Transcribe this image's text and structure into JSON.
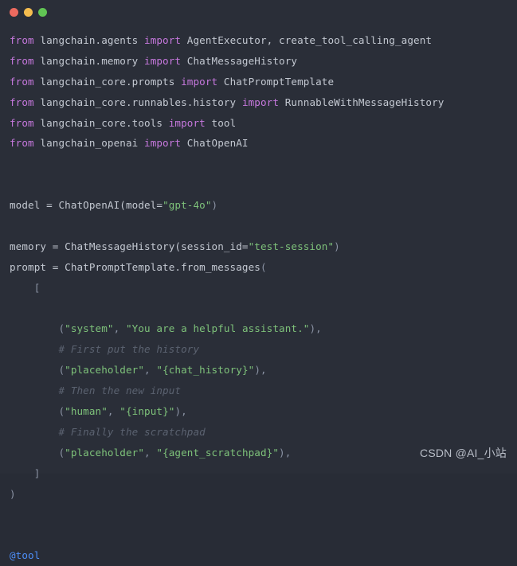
{
  "window": {
    "controls": [
      {
        "name": "close-button",
        "color": "#ec6a5f"
      },
      {
        "name": "minimize-button",
        "color": "#f5bd4f"
      },
      {
        "name": "maximize-button",
        "color": "#61c554"
      }
    ]
  },
  "theme": {
    "background": "#2a2e38",
    "foreground": "#c3c8d1",
    "keyword": "#c678dd",
    "string": "#7ec27a",
    "comment": "#5b6270",
    "punctuation": "#8b93a4",
    "decorator": "#4d8ef7"
  },
  "code": {
    "language": "python",
    "lines": [
      {
        "n": 1,
        "tokens": [
          {
            "t": "kw",
            "v": "from"
          },
          {
            "t": "id",
            "v": " langchain.agents "
          },
          {
            "t": "kw",
            "v": "import"
          },
          {
            "t": "id",
            "v": " AgentExecutor, create_tool_calling_agent"
          }
        ]
      },
      {
        "n": 2,
        "tokens": [
          {
            "t": "kw",
            "v": "from"
          },
          {
            "t": "id",
            "v": " langchain.memory "
          },
          {
            "t": "kw",
            "v": "import"
          },
          {
            "t": "id",
            "v": " ChatMessageHistory"
          }
        ]
      },
      {
        "n": 3,
        "tokens": [
          {
            "t": "kw",
            "v": "from"
          },
          {
            "t": "id",
            "v": " langchain_core.prompts "
          },
          {
            "t": "kw",
            "v": "import"
          },
          {
            "t": "id",
            "v": " ChatPromptTemplate"
          }
        ]
      },
      {
        "n": 4,
        "tokens": [
          {
            "t": "kw",
            "v": "from"
          },
          {
            "t": "id",
            "v": " langchain_core.runnables.history "
          },
          {
            "t": "kw",
            "v": "import"
          },
          {
            "t": "id",
            "v": " RunnableWithMessageHistory"
          }
        ]
      },
      {
        "n": 5,
        "tokens": [
          {
            "t": "kw",
            "v": "from"
          },
          {
            "t": "id",
            "v": " langchain_core.tools "
          },
          {
            "t": "kw",
            "v": "import"
          },
          {
            "t": "id",
            "v": " tool"
          }
        ]
      },
      {
        "n": 6,
        "tokens": [
          {
            "t": "kw",
            "v": "from"
          },
          {
            "t": "id",
            "v": " langchain_openai "
          },
          {
            "t": "kw",
            "v": "import"
          },
          {
            "t": "id",
            "v": " ChatOpenAI"
          }
        ]
      },
      {
        "n": 7,
        "tokens": []
      },
      {
        "n": 8,
        "tokens": []
      },
      {
        "n": 9,
        "tokens": [
          {
            "t": "id",
            "v": "model = ChatOpenAI(model="
          },
          {
            "t": "str",
            "v": "\"gpt-4o\""
          },
          {
            "t": "punc",
            "v": ")"
          }
        ]
      },
      {
        "n": 10,
        "tokens": []
      },
      {
        "n": 11,
        "tokens": [
          {
            "t": "id",
            "v": "memory = ChatMessageHistory(session_id="
          },
          {
            "t": "str",
            "v": "\"test-session\""
          },
          {
            "t": "punc",
            "v": ")"
          }
        ]
      },
      {
        "n": 12,
        "tokens": [
          {
            "t": "id",
            "v": "prompt = ChatPromptTemplate.from_messages"
          },
          {
            "t": "punc",
            "v": "("
          }
        ]
      },
      {
        "n": 13,
        "tokens": [
          {
            "t": "punc",
            "v": "    ["
          }
        ]
      },
      {
        "n": 14,
        "tokens": []
      },
      {
        "n": 15,
        "tokens": [
          {
            "t": "punc",
            "v": "        ("
          },
          {
            "t": "str",
            "v": "\"system\""
          },
          {
            "t": "punc",
            "v": ", "
          },
          {
            "t": "str",
            "v": "\"You are a helpful assistant.\""
          },
          {
            "t": "punc",
            "v": "),"
          }
        ]
      },
      {
        "n": 16,
        "tokens": [
          {
            "t": "com",
            "v": "        # First put the history"
          }
        ]
      },
      {
        "n": 17,
        "tokens": [
          {
            "t": "punc",
            "v": "        ("
          },
          {
            "t": "str",
            "v": "\"placeholder\""
          },
          {
            "t": "punc",
            "v": ", "
          },
          {
            "t": "str",
            "v": "\"{chat_history}\""
          },
          {
            "t": "punc",
            "v": "),"
          }
        ]
      },
      {
        "n": 18,
        "tokens": [
          {
            "t": "com",
            "v": "        # Then the new input"
          }
        ]
      },
      {
        "n": 19,
        "tokens": [
          {
            "t": "punc",
            "v": "        ("
          },
          {
            "t": "str",
            "v": "\"human\""
          },
          {
            "t": "punc",
            "v": ", "
          },
          {
            "t": "str",
            "v": "\"{input}\""
          },
          {
            "t": "punc",
            "v": "),"
          }
        ]
      },
      {
        "n": 20,
        "tokens": [
          {
            "t": "com",
            "v": "        # Finally the scratchpad"
          }
        ]
      },
      {
        "n": 21,
        "tokens": [
          {
            "t": "punc",
            "v": "        ("
          },
          {
            "t": "str",
            "v": "\"placeholder\""
          },
          {
            "t": "punc",
            "v": ", "
          },
          {
            "t": "str",
            "v": "\"{agent_scratchpad}\""
          },
          {
            "t": "punc",
            "v": "),"
          }
        ]
      },
      {
        "n": 22,
        "tokens": [
          {
            "t": "punc",
            "v": "    ]"
          }
        ]
      },
      {
        "n": 23,
        "tokens": [
          {
            "t": "punc",
            "v": ")"
          }
        ]
      },
      {
        "n": 24,
        "tokens": []
      },
      {
        "n": 25,
        "tokens": []
      },
      {
        "n": 26,
        "tokens": [
          {
            "t": "dec",
            "v": "@tool"
          }
        ]
      }
    ]
  },
  "watermark": {
    "text": "CSDN @AI_小站"
  }
}
